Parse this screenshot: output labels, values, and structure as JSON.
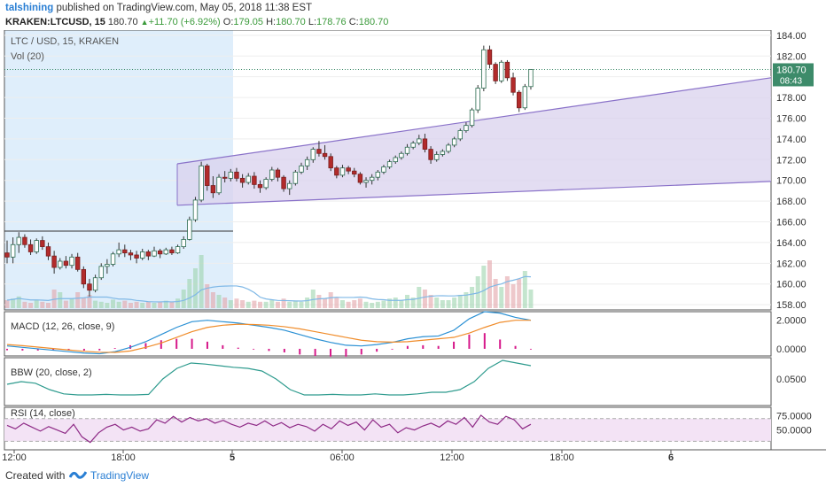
{
  "header": {
    "author": "talshining",
    "published": "published on TradingView.com, May 05, 2018 11:38 EST",
    "symbol": "KRAKEN:LTCUSD, 15",
    "last": "180.70",
    "change": "+11.70 (+6.92%)",
    "o_label": "O:",
    "o_value": "179.05",
    "h_label": "H:",
    "h_value": "180.70",
    "l_label": "L:",
    "l_value": "178.76",
    "c_label": "C:",
    "c_value": "180.70"
  },
  "footer": {
    "created_with": "Created with",
    "brand": "TradingView"
  },
  "colors": {
    "up": "#3d8b6a",
    "down": "#b22b2b",
    "channel_fill": "#d9d2ee",
    "channel_line": "#8a72c9",
    "macd": "#2a90d4",
    "signal": "#f08c2a",
    "hist": "#d6198a",
    "bbw": "#2e9b8e",
    "rsi": "#8e2a86",
    "highlight": "#dfeefb",
    "price_badge": "#3d8b6a"
  },
  "chart_data": [
    {
      "type": "candlestick",
      "title": "LTC / USD, 15, KRAKEN",
      "volume_label": "Vol (20)",
      "price_badge": "180.70",
      "countdown": "08:43",
      "ylim": [
        157.5,
        184.5
      ],
      "y_ticks": [
        "184.00",
        "182.00",
        "180.00",
        "178.00",
        "176.00",
        "174.00",
        "172.00",
        "170.00",
        "168.00",
        "166.00",
        "164.00",
        "162.00",
        "160.00",
        "158.00"
      ],
      "x_ticks": [
        "12:00",
        "18:00",
        "5",
        "06:00",
        "12:00",
        "18:00",
        "6"
      ],
      "channel": {
        "lower_start": [
          167.6,
          169.9
        ],
        "upper_start": [
          171.6,
          179.9
        ]
      },
      "ohlc": [
        [
          163.0,
          164.2,
          162.0,
          162.6
        ],
        [
          162.6,
          164.5,
          162.0,
          163.8
        ],
        [
          163.8,
          165.0,
          163.0,
          164.5
        ],
        [
          164.5,
          164.8,
          163.5,
          163.8
        ],
        [
          163.8,
          164.3,
          162.8,
          163.1
        ],
        [
          163.1,
          164.4,
          162.9,
          164.2
        ],
        [
          164.2,
          164.6,
          163.3,
          163.6
        ],
        [
          163.6,
          164.0,
          162.3,
          162.7
        ],
        [
          162.7,
          163.2,
          161.0,
          161.6
        ],
        [
          161.6,
          162.5,
          161.4,
          162.2
        ],
        [
          162.2,
          162.7,
          161.5,
          161.8
        ],
        [
          161.8,
          162.9,
          161.5,
          162.6
        ],
        [
          162.6,
          163.0,
          161.2,
          161.4
        ],
        [
          161.4,
          161.7,
          159.6,
          160.0
        ],
        [
          160.0,
          160.5,
          158.8,
          159.4
        ],
        [
          159.4,
          160.9,
          159.2,
          160.6
        ],
        [
          160.6,
          162.0,
          160.4,
          161.7
        ],
        [
          161.7,
          162.4,
          161.0,
          161.9
        ],
        [
          161.9,
          163.1,
          161.7,
          162.9
        ],
        [
          162.9,
          164.0,
          162.6,
          163.3
        ],
        [
          163.3,
          163.8,
          162.6,
          163.0
        ],
        [
          163.0,
          163.3,
          162.3,
          162.8
        ],
        [
          162.8,
          163.2,
          162.0,
          162.5
        ],
        [
          162.5,
          163.4,
          162.3,
          163.1
        ],
        [
          163.1,
          163.3,
          162.3,
          162.7
        ],
        [
          162.7,
          163.6,
          162.6,
          163.2
        ],
        [
          163.2,
          163.4,
          162.5,
          162.9
        ],
        [
          162.9,
          163.5,
          162.8,
          163.3
        ],
        [
          163.3,
          163.6,
          162.8,
          163.0
        ],
        [
          163.0,
          163.8,
          162.9,
          163.6
        ],
        [
          163.6,
          164.6,
          163.4,
          164.3
        ],
        [
          164.3,
          166.5,
          164.2,
          166.2
        ],
        [
          166.2,
          168.4,
          166.0,
          168.1
        ],
        [
          168.1,
          171.8,
          167.9,
          171.4
        ],
        [
          171.4,
          171.6,
          169.0,
          169.5
        ],
        [
          169.5,
          170.4,
          168.3,
          168.8
        ],
        [
          168.8,
          170.6,
          168.6,
          170.3
        ],
        [
          170.3,
          170.9,
          169.8,
          170.2
        ],
        [
          170.2,
          171.1,
          169.9,
          170.8
        ],
        [
          170.8,
          171.2,
          169.9,
          170.2
        ],
        [
          170.2,
          170.6,
          169.3,
          169.8
        ],
        [
          169.8,
          170.7,
          169.6,
          170.4
        ],
        [
          170.4,
          170.8,
          169.2,
          169.6
        ],
        [
          169.6,
          170.0,
          168.8,
          169.3
        ],
        [
          169.3,
          170.3,
          169.1,
          170.1
        ],
        [
          170.1,
          171.3,
          169.9,
          171.0
        ],
        [
          171.0,
          171.2,
          169.9,
          170.3
        ],
        [
          170.3,
          170.5,
          168.9,
          169.2
        ],
        [
          169.2,
          170.0,
          168.6,
          169.7
        ],
        [
          169.7,
          171.0,
          169.5,
          170.8
        ],
        [
          170.8,
          171.7,
          170.6,
          171.4
        ],
        [
          171.4,
          172.3,
          171.0,
          172.0
        ],
        [
          172.0,
          173.2,
          171.7,
          173.0
        ],
        [
          173.0,
          173.8,
          172.3,
          172.6
        ],
        [
          172.6,
          173.4,
          172.0,
          172.3
        ],
        [
          172.3,
          172.6,
          170.9,
          171.2
        ],
        [
          171.2,
          171.4,
          170.2,
          170.5
        ],
        [
          170.5,
          171.5,
          170.3,
          171.2
        ],
        [
          171.2,
          171.4,
          170.6,
          170.9
        ],
        [
          170.9,
          171.2,
          170.3,
          170.6
        ],
        [
          170.6,
          170.8,
          169.6,
          169.8
        ],
        [
          169.8,
          170.3,
          169.3,
          170.0
        ],
        [
          170.0,
          170.6,
          169.6,
          170.3
        ],
        [
          170.3,
          171.0,
          170.0,
          170.8
        ],
        [
          170.8,
          171.5,
          170.6,
          171.3
        ],
        [
          171.3,
          172.0,
          171.1,
          171.8
        ],
        [
          171.8,
          172.4,
          171.6,
          172.2
        ],
        [
          172.2,
          172.8,
          172.0,
          172.6
        ],
        [
          172.6,
          173.5,
          172.4,
          173.2
        ],
        [
          173.2,
          173.8,
          173.0,
          173.6
        ],
        [
          173.6,
          174.4,
          173.4,
          174.0
        ],
        [
          174.0,
          174.5,
          172.7,
          173.0
        ],
        [
          173.0,
          173.3,
          171.6,
          172.0
        ],
        [
          172.0,
          172.8,
          171.8,
          172.5
        ],
        [
          172.5,
          173.0,
          172.3,
          172.8
        ],
        [
          172.8,
          173.6,
          172.6,
          173.4
        ],
        [
          173.4,
          174.2,
          173.2,
          174.0
        ],
        [
          174.0,
          175.0,
          173.8,
          174.8
        ],
        [
          174.8,
          175.6,
          174.6,
          175.3
        ],
        [
          175.3,
          177.0,
          175.1,
          176.8
        ],
        [
          176.8,
          179.2,
          176.5,
          178.9
        ],
        [
          178.9,
          183.0,
          178.6,
          182.6
        ],
        [
          182.6,
          183.0,
          180.8,
          181.2
        ],
        [
          181.2,
          181.4,
          179.3,
          179.6
        ],
        [
          179.6,
          181.6,
          179.4,
          181.4
        ],
        [
          181.4,
          181.6,
          179.6,
          179.9
        ],
        [
          179.9,
          180.4,
          178.2,
          178.5
        ],
        [
          178.5,
          178.7,
          176.6,
          177.0
        ],
        [
          177.0,
          179.3,
          176.8,
          179.05
        ],
        [
          179.05,
          180.7,
          178.76,
          180.7
        ]
      ],
      "volume": [
        0.15,
        0.18,
        0.22,
        0.12,
        0.1,
        0.16,
        0.12,
        0.1,
        0.35,
        0.3,
        0.14,
        0.18,
        0.3,
        0.2,
        0.25,
        0.14,
        0.12,
        0.1,
        0.16,
        0.12,
        0.14,
        0.1,
        0.12,
        0.1,
        0.12,
        0.1,
        0.12,
        0.14,
        0.12,
        0.18,
        0.35,
        0.55,
        0.75,
        1.0,
        0.45,
        0.3,
        0.25,
        0.2,
        0.15,
        0.18,
        0.15,
        0.12,
        0.14,
        0.12,
        0.12,
        0.15,
        0.12,
        0.18,
        0.12,
        0.14,
        0.12,
        0.2,
        0.35,
        0.25,
        0.18,
        0.3,
        0.2,
        0.15,
        0.12,
        0.15,
        0.18,
        0.12,
        0.1,
        0.12,
        0.14,
        0.18,
        0.2,
        0.15,
        0.25,
        0.2,
        0.4,
        0.35,
        0.25,
        0.2,
        0.15,
        0.15,
        0.2,
        0.25,
        0.3,
        0.4,
        0.6,
        0.8,
        0.9,
        0.55,
        0.4,
        0.6,
        0.45,
        0.55,
        0.7,
        0.35
      ]
    },
    {
      "type": "line",
      "label": "MACD (12, 26, close, 9)",
      "ylim": [
        -0.5,
        2.6
      ],
      "y_ticks": [
        "2.0000",
        "0.0000"
      ],
      "series": [
        {
          "name": "MACD",
          "values": [
            0.2,
            0.1,
            0.0,
            -0.1,
            -0.2,
            -0.3,
            -0.35,
            -0.2,
            0.1,
            0.5,
            1.0,
            1.5,
            1.9,
            2.0,
            1.9,
            1.8,
            1.65,
            1.5,
            1.3,
            1.0,
            0.7,
            0.45,
            0.25,
            0.2,
            0.3,
            0.45,
            0.7,
            0.85,
            0.9,
            1.3,
            2.1,
            2.6,
            2.5,
            2.2,
            2.0
          ]
        },
        {
          "name": "Signal",
          "values": [
            0.3,
            0.22,
            0.12,
            0.02,
            -0.08,
            -0.18,
            -0.24,
            -0.25,
            -0.15,
            0.1,
            0.4,
            0.8,
            1.2,
            1.5,
            1.65,
            1.72,
            1.7,
            1.65,
            1.55,
            1.4,
            1.2,
            1.0,
            0.8,
            0.6,
            0.5,
            0.47,
            0.5,
            0.6,
            0.7,
            0.8,
            1.1,
            1.5,
            1.85,
            2.0,
            2.0
          ]
        }
      ],
      "histogram": [
        -0.1,
        -0.12,
        -0.12,
        -0.12,
        -0.12,
        -0.12,
        -0.11,
        0.05,
        0.25,
        0.4,
        0.6,
        0.7,
        0.7,
        0.5,
        0.25,
        0.08,
        -0.05,
        -0.15,
        -0.25,
        -0.4,
        -0.5,
        -0.55,
        -0.55,
        -0.4,
        -0.2,
        -0.02,
        0.2,
        0.25,
        0.2,
        0.5,
        1.0,
        1.1,
        0.65,
        0.2,
        0.0
      ]
    },
    {
      "type": "line",
      "label": "BBW (20, close, 2)",
      "ylim": [
        0.0,
        0.09
      ],
      "y_ticks": [
        "0.0500"
      ],
      "series": [
        {
          "name": "BBW",
          "values": [
            0.04,
            0.045,
            0.042,
            0.03,
            0.022,
            0.02,
            0.02,
            0.021,
            0.02,
            0.02,
            0.021,
            0.05,
            0.07,
            0.08,
            0.078,
            0.075,
            0.072,
            0.07,
            0.065,
            0.05,
            0.03,
            0.02,
            0.02,
            0.021,
            0.02,
            0.02,
            0.022,
            0.02,
            0.02,
            0.022,
            0.025,
            0.025,
            0.03,
            0.045,
            0.07,
            0.085,
            0.08,
            0.075
          ]
        }
      ]
    },
    {
      "type": "line",
      "label": "RSI (14, close)",
      "ylim": [
        15,
        90
      ],
      "y_ticks": [
        "75.0000",
        "50.0000"
      ],
      "band": [
        30,
        70
      ],
      "series": [
        {
          "name": "RSI",
          "values": [
            58,
            52,
            62,
            55,
            48,
            56,
            50,
            44,
            60,
            38,
            28,
            45,
            55,
            60,
            50,
            55,
            48,
            52,
            68,
            62,
            74,
            64,
            72,
            66,
            70,
            62,
            67,
            60,
            55,
            62,
            58,
            66,
            57,
            63,
            54,
            60,
            56,
            48,
            60,
            52,
            66,
            58,
            64,
            50,
            68,
            55,
            60,
            45,
            54,
            50,
            57,
            62,
            55,
            66,
            60,
            72,
            55,
            76,
            64,
            60,
            74,
            68,
            52,
            60
          ]
        }
      ]
    }
  ]
}
